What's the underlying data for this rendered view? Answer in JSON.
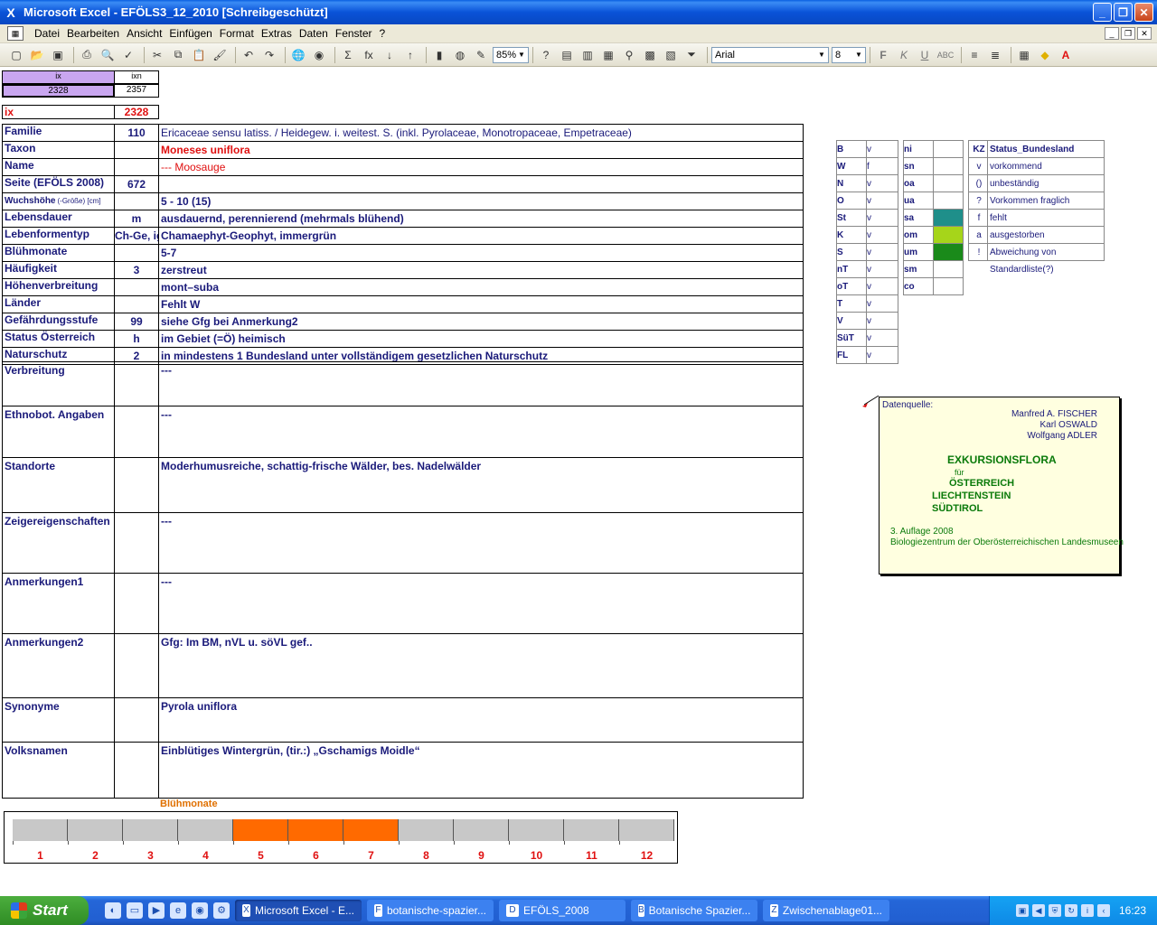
{
  "window": {
    "title": "Microsoft Excel - EFÖLS3_12_2010  [Schreibgeschützt]",
    "app_glyph": "X"
  },
  "menu": [
    "Datei",
    "Bearbeiten",
    "Ansicht",
    "Einfügen",
    "Format",
    "Extras",
    "Daten",
    "Fenster",
    "?"
  ],
  "toolbar": {
    "zoom": "85%",
    "font": "Arial",
    "size": "8"
  },
  "top_cells": {
    "ix_hdr": "ix",
    "ixn_hdr": "ixn",
    "ix_val": "2328",
    "ixn_val": "2357",
    "ix_label": "ix",
    "ix_red": "2328"
  },
  "rows": [
    {
      "label": "Familie",
      "code": "110",
      "text": "Ericaceae sensu latiss.  /  Heidegew. i. weitest. S. (inkl. Pyrolaceae, Monotropaceae, Empetraceae)"
    },
    {
      "label": "Taxon",
      "code": "",
      "text": "Moneses uniflora"
    },
    {
      "label": "Name",
      "code": "",
      "text": "--- Moosauge"
    },
    {
      "label": "Seite (EFÖLS 2008)",
      "code": "672",
      "text": ""
    },
    {
      "label": "Wuchshöhe",
      "label_small": "(-Größe) [cm]",
      "code": "",
      "text": " 5 - 10 (15)"
    },
    {
      "label": "Lebensdauer",
      "code": "m",
      "text": "ausdauernd, perennierend (mehrmals blühend)"
    },
    {
      "label": "Lebenformentyp",
      "code": "Ch-Ge, ig",
      "text": "Chamaephyt-Geophyt, immergrün"
    },
    {
      "label": "Blühmonate",
      "code": "",
      "text": " 5-7"
    },
    {
      "label": "Häufigkeit",
      "code": "3",
      "text": "zerstreut"
    },
    {
      "label": "Höhenverbreitung",
      "code": "",
      "text": "mont–suba"
    },
    {
      "label": "Länder",
      "code": "",
      "text": "Fehlt W"
    },
    {
      "label": "Gefährdungsstufe",
      "code": "99",
      "text": "siehe Gfg bei Anmerkung2"
    },
    {
      "label": "Status Österreich",
      "code": "h",
      "text": "im Gebiet (=Ö) heimisch"
    },
    {
      "label": "Naturschutz",
      "code": "2",
      "text": "in mindestens 1 Bundesland unter vollständigem gesetzlichen Naturschutz"
    }
  ],
  "tall_rows": [
    {
      "label": "Verbreitung",
      "text": " ---"
    },
    {
      "label": "Ethnobot. Angaben",
      "text": "---"
    },
    {
      "label": "Standorte",
      "text": "Moderhumusreiche, schattig-frische Wälder, bes. Nadelwälder"
    },
    {
      "label": "Zeigereigenschaften",
      "text": "---"
    },
    {
      "label": "Anmerkungen1",
      "text": "---"
    },
    {
      "label": "Anmerkungen2",
      "text": "Gfg: Im BM, nVL u. söVL gef.."
    },
    {
      "label": "Synonyme",
      "text": "Pyrola uniflora"
    },
    {
      "label": "Volksnamen",
      "text": "Einblütiges Wintergrün, (tir.:) „Gschamigs Moidle“"
    }
  ],
  "regions": [
    {
      "k": "B",
      "v": "v"
    },
    {
      "k": "W",
      "v": "f"
    },
    {
      "k": "N",
      "v": "v"
    },
    {
      "k": "O",
      "v": "v"
    },
    {
      "k": "St",
      "v": "v"
    },
    {
      "k": "K",
      "v": "v"
    },
    {
      "k": "S",
      "v": "v"
    },
    {
      "k": "nT",
      "v": "v"
    },
    {
      "k": "oT",
      "v": "v"
    },
    {
      "k": "T",
      "v": "v"
    },
    {
      "k": "V",
      "v": "v"
    },
    {
      "k": "SüT",
      "v": "v"
    },
    {
      "k": "FL",
      "v": "v"
    }
  ],
  "zones": [
    {
      "k": "ni",
      "color": ""
    },
    {
      "k": "sn",
      "color": ""
    },
    {
      "k": "oa",
      "color": ""
    },
    {
      "k": "ua",
      "color": ""
    },
    {
      "k": "sa",
      "color": "#1f8f8a"
    },
    {
      "k": "om",
      "color": "#a6d51a"
    },
    {
      "k": "um",
      "color": "#1a8a1a"
    },
    {
      "k": "sm",
      "color": ""
    },
    {
      "k": "co",
      "color": ""
    }
  ],
  "legend": {
    "header_k": "KZ",
    "header_v": "Status_Bundesland",
    "items": [
      {
        "k": "v",
        "v": "vorkommend"
      },
      {
        "k": "()",
        "v": "unbeständig"
      },
      {
        "k": "?",
        "v": "Vorkommen fraglich"
      },
      {
        "k": "f",
        "v": "fehlt"
      },
      {
        "k": "a",
        "v": "ausgestorben"
      },
      {
        "k": "!",
        "v": "Abweichung von Standardliste(?)"
      }
    ]
  },
  "info": {
    "source": "Datenquelle:",
    "authors": [
      "Manfred A. FISCHER",
      "Karl OSWALD",
      "Wolfgang ADLER"
    ],
    "title": "EXKURSIONSFLORA",
    "fuer": "für",
    "countries": [
      "ÖSTERREICH",
      "LIECHTENSTEIN",
      "SÜDTIROL"
    ],
    "edition": "3. Auflage 2008",
    "publisher": "Biologiezentrum der Oberösterreichischen Landesmuseen"
  },
  "bloom": {
    "label": "Blühmonate",
    "months": [
      "1",
      "2",
      "3",
      "4",
      "5",
      "6",
      "7",
      "8",
      "9",
      "10",
      "11",
      "12"
    ],
    "active": [
      false,
      false,
      false,
      false,
      true,
      true,
      true,
      false,
      false,
      false,
      false,
      false
    ],
    "on_color": "#ff6a00",
    "off_color": "#c8c8c8"
  },
  "taskbar": {
    "start": "Start",
    "tasks": [
      {
        "label": "Microsoft Excel - E...",
        "active": true,
        "icon": "X"
      },
      {
        "label": "botanische-spazier...",
        "active": false,
        "icon": "F"
      },
      {
        "label": "EFÖLS_2008",
        "active": false,
        "icon": "D"
      },
      {
        "label": "Botanische Spazier...",
        "active": false,
        "icon": "B"
      },
      {
        "label": "Zwischenablage01...",
        "active": false,
        "icon": "Z"
      }
    ],
    "clock": "16:23"
  }
}
